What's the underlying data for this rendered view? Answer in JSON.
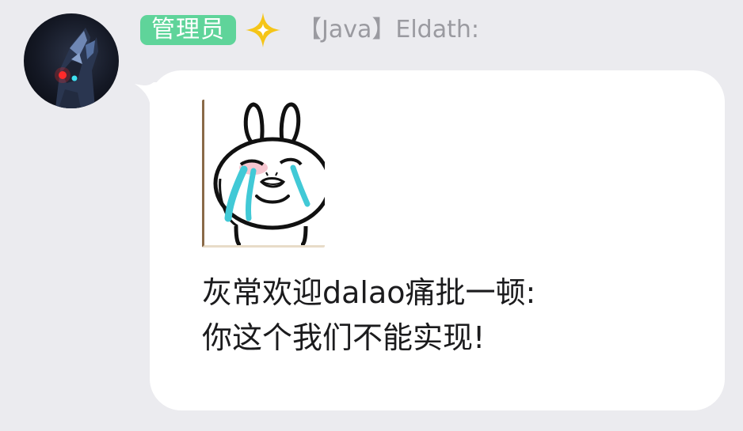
{
  "message": {
    "sender": {
      "role_badge": "管理员",
      "name": "【Java】Eldath:",
      "avatar_icon": "armored-hero-avatar",
      "badge_icon": "four-point-star-icon"
    },
    "sticker": {
      "icon": "crying-rabbit-sticker"
    },
    "text_lines": [
      "灰常欢迎dalao痛批一顿:",
      "你这个我们不能实现!"
    ]
  },
  "colors": {
    "background": "#ebebef",
    "bubble": "#ffffff",
    "role_badge": "#5fd49a",
    "star": "#f5c518",
    "name_text": "#9a9aa0",
    "message_text": "#1b1b1d",
    "tears": "#41c9d6"
  }
}
